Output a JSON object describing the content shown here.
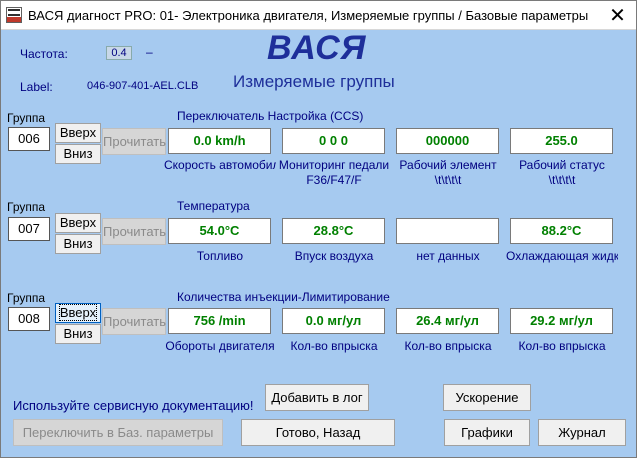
{
  "window": {
    "title": "ВАСЯ диагност PRO: 01- Электроника двигателя,  Измеряемые группы / Базовые параметры",
    "close_glyph": "✕"
  },
  "header": {
    "freq_label": "Частота:",
    "freq_value": "0.4",
    "freq_dash": "–",
    "brand": "ВАСЯ",
    "label_caption": "Label:",
    "label_value": "046-907-401-AEL.CLB",
    "subtitle": "Измеряемые группы"
  },
  "groups": [
    {
      "label": "Группа",
      "number": "006",
      "up": "Вверх",
      "down": "Вниз",
      "read": "Прочитать",
      "title": "Переключатель Настройка (CCS)",
      "fields": [
        {
          "value": "0.0 km/h",
          "cap1": "Скорость автомобиля",
          "cap2": ""
        },
        {
          "value": "0  0  0",
          "cap1": "Мониторинг педали",
          "cap2": "F36/F47/F"
        },
        {
          "value": "000000",
          "cap1": "Рабочий элемент",
          "cap2": "\\t\\t\\t\\t"
        },
        {
          "value": "255.0",
          "cap1": "Рабочий статус",
          "cap2": "\\t\\t\\t\\t"
        }
      ]
    },
    {
      "label": "Группа",
      "number": "007",
      "up": "Вверх",
      "down": "Вниз",
      "read": "Прочитать",
      "title": "Температура",
      "fields": [
        {
          "value": "54.0°C",
          "cap1": "Топливо",
          "cap2": ""
        },
        {
          "value": "28.8°C",
          "cap1": "Впуск воздуха",
          "cap2": ""
        },
        {
          "value": "",
          "cap1": "нет данных",
          "cap2": ""
        },
        {
          "value": "88.2°C",
          "cap1": "Охлаждающая жидкость",
          "cap2": ""
        }
      ]
    },
    {
      "label": "Группа",
      "number": "008",
      "up": "Вверх",
      "down": "Вниз",
      "read": "Прочитать",
      "title": "Количества инъекции-Лимитирование",
      "fields": [
        {
          "value": "756 /min",
          "cap1": "Обороты двигателя",
          "cap2": ""
        },
        {
          "value": "0.0 мг/ул",
          "cap1": "Кол-во впрыска",
          "cap2": ""
        },
        {
          "value": "26.4 мг/ул",
          "cap1": "Кол-во впрыска",
          "cap2": ""
        },
        {
          "value": "29.2 мг/ул",
          "cap1": "Кол-во впрыска",
          "cap2": ""
        }
      ]
    }
  ],
  "footer": {
    "hint": "Используйте сервисную документацию!",
    "add_log": "Добавить в лог",
    "accel": "Ускорение",
    "switch_basic": "Переключить в Баз. параметры",
    "done_back": "Готово, Назад",
    "graphs": "Графики",
    "journal": "Журнал"
  }
}
